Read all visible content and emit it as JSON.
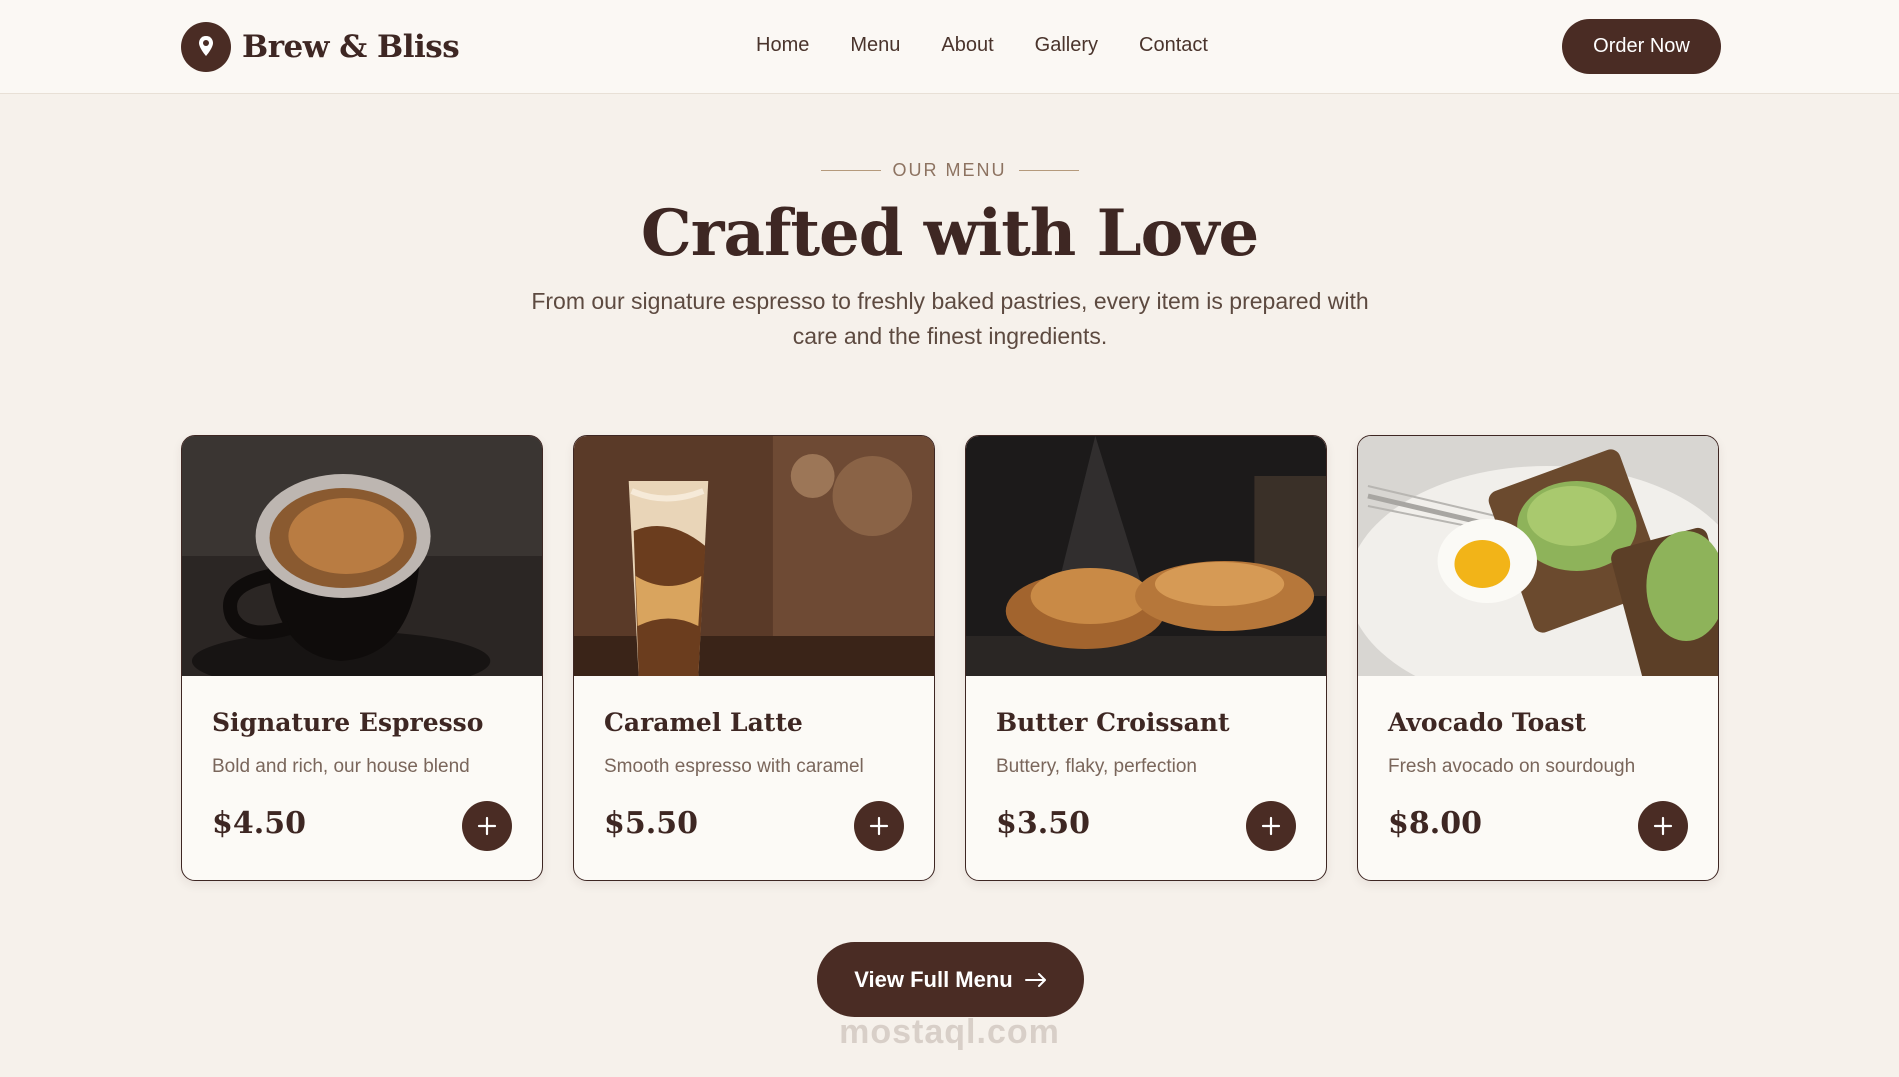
{
  "brand": {
    "name": "Brew & Bliss",
    "icon": "pin-icon"
  },
  "nav": {
    "items": [
      "Home",
      "Menu",
      "About",
      "Gallery",
      "Contact"
    ]
  },
  "header": {
    "cta_label": "Order Now"
  },
  "hero": {
    "eyebrow": "OUR MENU",
    "title": "Crafted with Love",
    "subtitle": "From our signature espresso to freshly baked pastries, every item is prepared with care and the finest ingredients."
  },
  "menu": {
    "items": [
      {
        "title": "Signature Espresso",
        "desc": "Bold and rich, our house blend",
        "price": "$4.50",
        "image": "espresso-photo"
      },
      {
        "title": "Caramel Latte",
        "desc": "Smooth espresso with caramel",
        "price": "$5.50",
        "image": "iced-latte-photo"
      },
      {
        "title": "Butter Croissant",
        "desc": "Buttery, flaky, perfection",
        "price": "$3.50",
        "image": "croissant-photo"
      },
      {
        "title": "Avocado Toast",
        "desc": "Fresh avocado on sourdough",
        "price": "$8.00",
        "image": "avocado-toast-photo"
      }
    ]
  },
  "footer": {
    "view_label": "View Full Menu",
    "watermark": "mostaql.com"
  },
  "colors": {
    "primary": "#4a2c24",
    "background": "#f6f1eb",
    "text": "#3e2723"
  }
}
